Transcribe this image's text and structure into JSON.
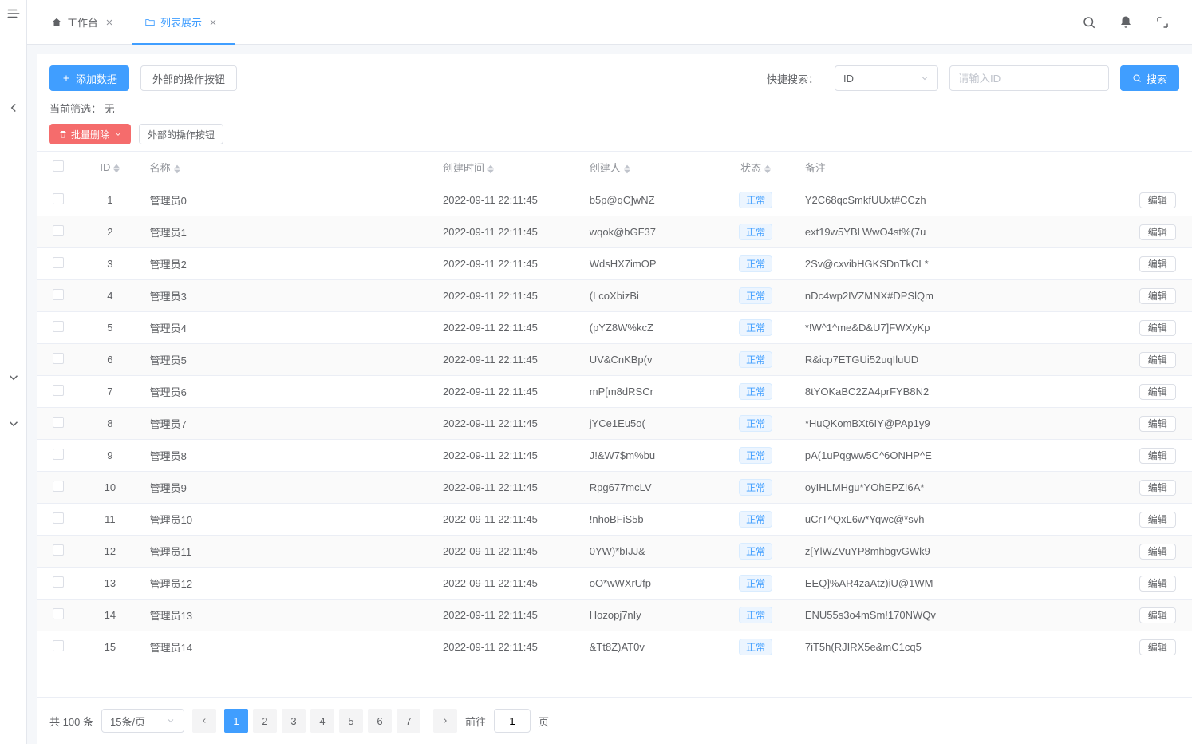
{
  "tabs": [
    {
      "label": "工作台",
      "icon": "home"
    },
    {
      "label": "列表展示",
      "icon": "folder",
      "active": true
    }
  ],
  "toolbar": {
    "add_label": "添加数据",
    "external_btn": "外部的操作按钮",
    "quick_search_label": "快捷搜索：",
    "search_field": "ID",
    "search_placeholder": "请输入ID",
    "search_btn": "搜索"
  },
  "filter": {
    "label": "当前筛选：",
    "value": "无"
  },
  "batch": {
    "delete_label": "批量删除",
    "external_btn": "外部的操作按钮"
  },
  "columns": [
    "ID",
    "名称",
    "创建时间",
    "创建人",
    "状态",
    "备注"
  ],
  "status_tag": "正常",
  "action_label": "编辑",
  "rows": [
    {
      "id": "1",
      "name": "管理员0",
      "time": "2022-09-11 22:11:45",
      "creator": "b5p@qC]wNZ",
      "remark": "Y2C68qcSmkfUUxt#CCzh"
    },
    {
      "id": "2",
      "name": "管理员1",
      "time": "2022-09-11 22:11:45",
      "creator": "wqok@bGF37",
      "remark": "ext19w5YBLWwO4st%(7u"
    },
    {
      "id": "3",
      "name": "管理员2",
      "time": "2022-09-11 22:11:45",
      "creator": "WdsHX7imOP",
      "remark": "2Sv@cxvibHGKSDnTkCL*"
    },
    {
      "id": "4",
      "name": "管理员3",
      "time": "2022-09-11 22:11:45",
      "creator": "(LcoXbizBi",
      "remark": "nDc4wp2IVZMNX#DPSlQm"
    },
    {
      "id": "5",
      "name": "管理员4",
      "time": "2022-09-11 22:11:45",
      "creator": "(pYZ8W%kcZ",
      "remark": "*!W^1^me&D&U7]FWXyKp"
    },
    {
      "id": "6",
      "name": "管理员5",
      "time": "2022-09-11 22:11:45",
      "creator": "UV&CnKBp(v",
      "remark": "R&icp7ETGUi52uqIluUD"
    },
    {
      "id": "7",
      "name": "管理员6",
      "time": "2022-09-11 22:11:45",
      "creator": "mP[m8dRSCr",
      "remark": "8tYOKaBC2ZA4prFYB8N2"
    },
    {
      "id": "8",
      "name": "管理员7",
      "time": "2022-09-11 22:11:45",
      "creator": "jYCe1Eu5o(",
      "remark": "*HuQKomBXt6IY@PAp1y9"
    },
    {
      "id": "9",
      "name": "管理员8",
      "time": "2022-09-11 22:11:45",
      "creator": "J!&W7$m%bu",
      "remark": "pA(1uPqgww5C^6ONHP^E"
    },
    {
      "id": "10",
      "name": "管理员9",
      "time": "2022-09-11 22:11:45",
      "creator": "Rpg677mcLV",
      "remark": "oyIHLMHgu*YOhEPZ!6A*"
    },
    {
      "id": "11",
      "name": "管理员10",
      "time": "2022-09-11 22:11:45",
      "creator": "!nhoBFiS5b",
      "remark": "uCrT^QxL6w*Yqwc@*svh"
    },
    {
      "id": "12",
      "name": "管理员11",
      "time": "2022-09-11 22:11:45",
      "creator": "0YW)*bIJJ&",
      "remark": "z[YlWZVuYP8mhbgvGWk9"
    },
    {
      "id": "13",
      "name": "管理员12",
      "time": "2022-09-11 22:11:45",
      "creator": "oO*wWXrUfp",
      "remark": "EEQ]%AR4zaAtz)iU@1WM"
    },
    {
      "id": "14",
      "name": "管理员13",
      "time": "2022-09-11 22:11:45",
      "creator": "Hozopj7nIy",
      "remark": "ENU55s3o4mSm!170NWQv"
    },
    {
      "id": "15",
      "name": "管理员14",
      "time": "2022-09-11 22:11:45",
      "creator": "&Tt8Z)AT0v",
      "remark": "7iT5h(RJIRX5e&mC1cq5"
    }
  ],
  "pager": {
    "total_prefix": "共",
    "total": "100",
    "total_suffix": "条",
    "page_size": "15条/页",
    "pages": [
      "1",
      "2",
      "3",
      "4",
      "5",
      "6",
      "7"
    ],
    "active_page": "1",
    "goto_label": "前往",
    "goto_value": "1",
    "goto_suffix": "页"
  }
}
